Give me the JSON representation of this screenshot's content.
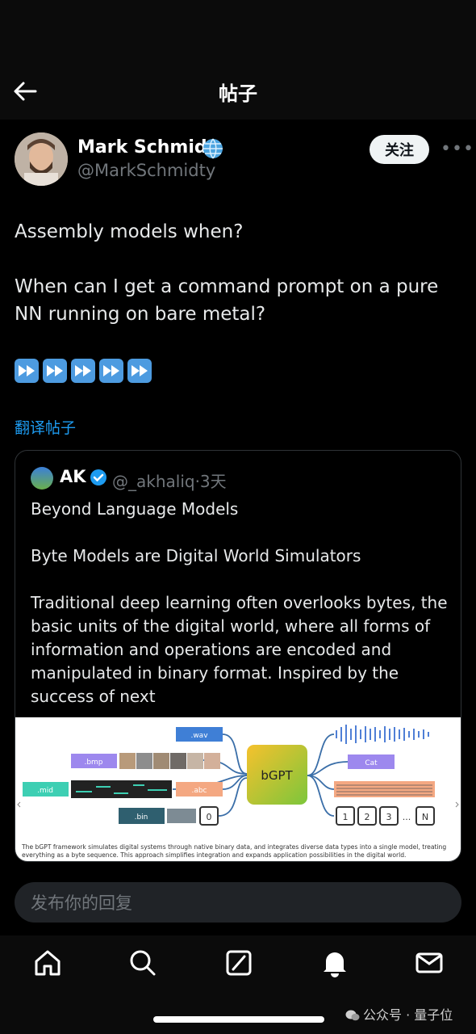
{
  "header": {
    "title": "帖子"
  },
  "author": {
    "name": "Mark Schmidt",
    "handle": "@MarkSchmidty",
    "follow_label": "关注",
    "more_label": "•••"
  },
  "post": {
    "lines": [
      "Assembly models when?",
      "When can I get a command prompt on a pure NN running on bare metal?"
    ],
    "emoji_count": 5,
    "translate_label": "翻译帖子"
  },
  "quoted": {
    "name": "AK",
    "handle": "@_akhaliq",
    "time": "·3天",
    "title": "Beyond Language Models",
    "subtitle": "Byte Models are Digital World Simulators",
    "body": "Traditional deep learning often overlooks bytes, the basic units of the digital world, where all forms of information and operations are encoded and manipulated in binary format. Inspired by the success of next",
    "figure": {
      "center": "bGPT",
      "inputs": [
        ".wav",
        ".bmp",
        ".mid",
        ".abc",
        ".bin"
      ],
      "outputs": [
        "Cat"
      ],
      "zero": "0",
      "out_digits": [
        "1",
        "2",
        "3",
        "N"
      ],
      "ellipsis": "...",
      "caption": "The bGPT framework simulates digital systems through native binary data, and integrates diverse data types into a single model, treating everything as a byte sequence. This approach simplifies integration and expands application possibilities in the digital world."
    }
  },
  "reply": {
    "placeholder": "发布你的回复"
  },
  "watermark": "公众号 · 量子位",
  "colors": {
    "accent": "#1d9bf0",
    "background": "#000000"
  }
}
